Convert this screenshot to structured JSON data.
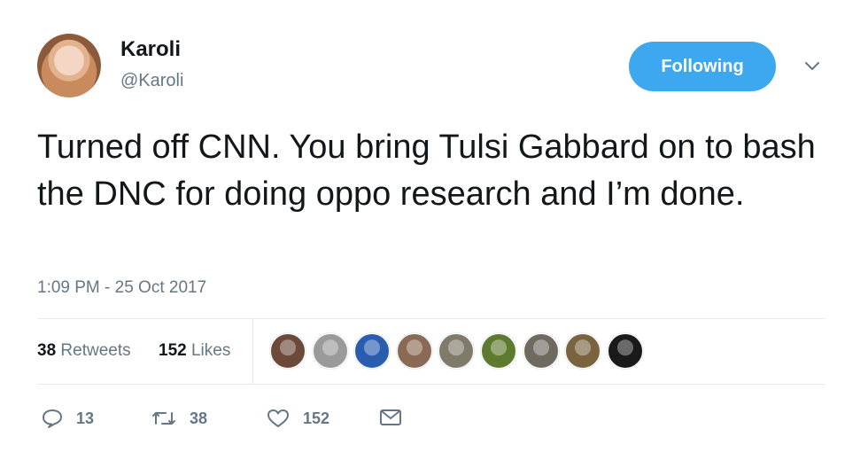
{
  "user": {
    "name": "Karoli",
    "handle": "@Karoli"
  },
  "follow_button": {
    "label": "Following"
  },
  "tweet": {
    "text": "Turned off CNN. You bring Tulsi Gabbard on to bash the DNC for doing oppo research and I’m done.",
    "timestamp": "1:09 PM - 25 Oct 2017"
  },
  "stats": {
    "retweets_count": "38",
    "retweets_label": "Retweets",
    "likes_count": "152",
    "likes_label": "Likes"
  },
  "likers_avatar_colors": [
    "#6b4a3a",
    "#9a9a9a",
    "#2a5db0",
    "#8a6a55",
    "#7f7a6a",
    "#5d7a2e",
    "#6e6a60",
    "#7a6440",
    "#1a1a1a"
  ],
  "actions": {
    "replies": "13",
    "retweets": "38",
    "likes": "152"
  },
  "icons": [
    "reply-icon",
    "retweet-icon",
    "heart-icon",
    "message-icon",
    "chevron-down-icon"
  ],
  "colors": {
    "accent": "#3da7f0",
    "muted": "#657786",
    "text": "#14171a",
    "divider": "#e6ecf0"
  }
}
